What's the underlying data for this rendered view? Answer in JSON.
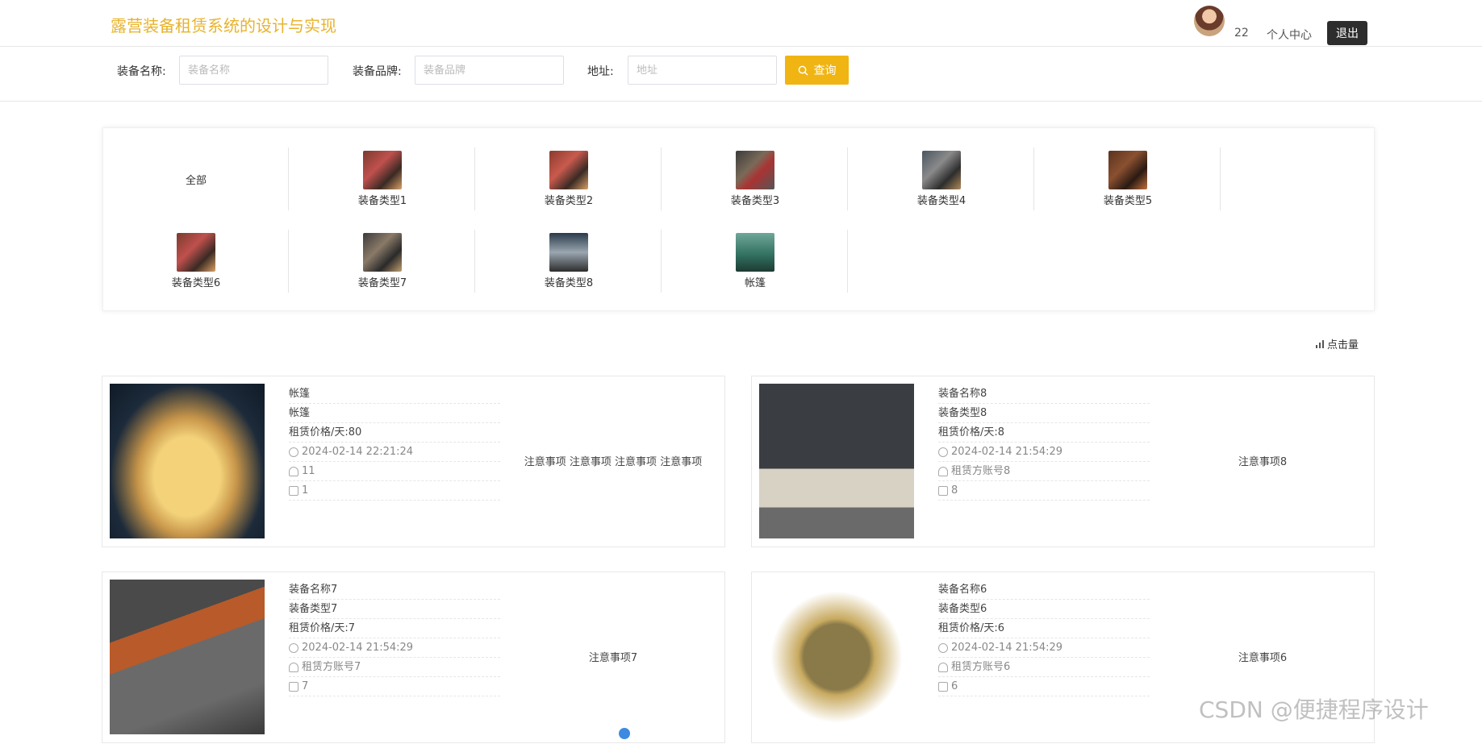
{
  "header": {
    "title": "露营装备租赁系统的设计与实现",
    "username": "22",
    "profile_label": "个人中心",
    "logout_label": "退出"
  },
  "search": {
    "name_label": "装备名称:",
    "name_placeholder": "装备名称",
    "brand_label": "装备品牌:",
    "brand_placeholder": "装备品牌",
    "address_label": "地址:",
    "address_placeholder": "地址",
    "query_label": "查询"
  },
  "categories": [
    {
      "label": "全部"
    },
    {
      "label": "装备类型1"
    },
    {
      "label": "装备类型2"
    },
    {
      "label": "装备类型3"
    },
    {
      "label": "装备类型4"
    },
    {
      "label": "装备类型5"
    },
    {
      "label": "装备类型6"
    },
    {
      "label": "装备类型7"
    },
    {
      "label": "装备类型8"
    },
    {
      "label": "帐篷"
    }
  ],
  "sort_label": "点击量",
  "items": [
    {
      "name": "帐篷",
      "type": "帐篷",
      "price": "租赁价格/天:80",
      "time": "2024-02-14 22:21:24",
      "account": "11",
      "count": "1",
      "note": "注意事项 注意事项 注意事项 注意事项"
    },
    {
      "name": "装备名称8",
      "type": "装备类型8",
      "price": "租赁价格/天:8",
      "time": "2024-02-14 21:54:29",
      "account": "租赁方账号8",
      "count": "8",
      "note": "注意事项8"
    },
    {
      "name": "装备名称7",
      "type": "装备类型7",
      "price": "租赁价格/天:7",
      "time": "2024-02-14 21:54:29",
      "account": "租赁方账号7",
      "count": "7",
      "note": "注意事项7"
    },
    {
      "name": "装备名称6",
      "type": "装备类型6",
      "price": "租赁价格/天:6",
      "time": "2024-02-14 21:54:29",
      "account": "租赁方账号6",
      "count": "6",
      "note": "注意事项6"
    }
  ],
  "watermark": "CSDN @便捷程序设计",
  "colors": {
    "brand": "#e8b32c",
    "query_button": "#f0b513",
    "logout_button": "#2d2d2d"
  }
}
